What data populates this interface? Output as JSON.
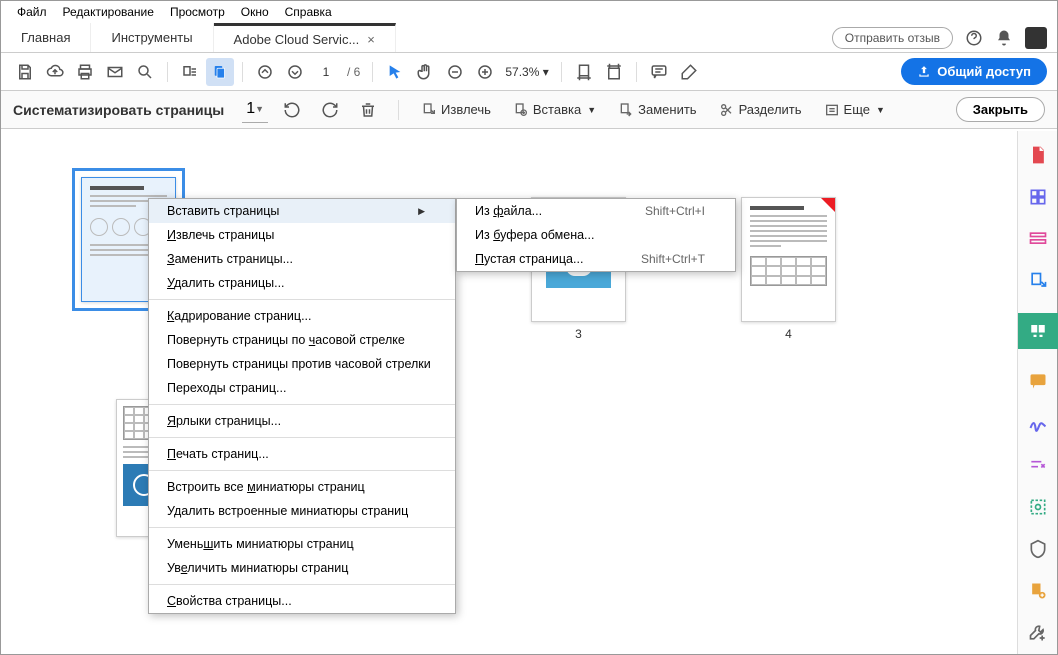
{
  "menubar": [
    "Файл",
    "Редактирование",
    "Просмотр",
    "Окно",
    "Справка"
  ],
  "tabs": {
    "home": "Главная",
    "tools": "Инструменты",
    "doc": "Adobe Cloud Servic..."
  },
  "tabright": {
    "review": "Отправить отзыв"
  },
  "toolbar": {
    "page": "1",
    "total": "/ 6",
    "zoom": "57.3%",
    "share": "Общий доступ"
  },
  "subbar": {
    "title": "Систематизировать страницы",
    "drop": "1",
    "extract": "Извлечь",
    "insert": "Вставка",
    "replace": "Заменить",
    "split": "Разделить",
    "more": "Еще",
    "close": "Закрыть"
  },
  "thumbs": {
    "p3": "3",
    "p4": "4"
  },
  "ctx_main": {
    "insert": "Вставить страницы",
    "extract": "Извлечь страницы",
    "replace": "Заменить страницы...",
    "delete": "Удалить страницы...",
    "crop": "Кадрирование страниц...",
    "rotcw": "Повернуть страницы по часовой стрелке",
    "rotccw": "Повернуть страницы против часовой стрелки",
    "trans": "Переходы страниц...",
    "labels": "Ярлыки страницы...",
    "print": "Печать страниц...",
    "embed": "Встроить все миниатюры страниц",
    "unembed": "Удалить встроенные миниатюры страниц",
    "smaller": "Уменьшить миниатюры страниц",
    "bigger": "Увеличить миниатюры страниц",
    "props": "Свойства страницы..."
  },
  "ctx_sub": {
    "file": "Из файла...",
    "file_sc": "Shift+Ctrl+I",
    "clip": "Из буфера обмена...",
    "blank": "Пустая страница...",
    "blank_sc": "Shift+Ctrl+T"
  }
}
